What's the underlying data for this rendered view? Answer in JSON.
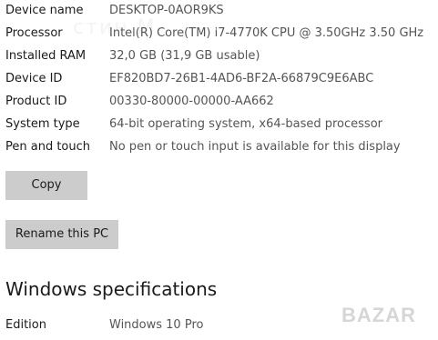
{
  "specs": [
    {
      "label": "Device name",
      "value": "DESKTOP-0AOR9KS"
    },
    {
      "label": "Processor",
      "value": "Intel(R) Core(TM) i7-4770K CPU @ 3.50GHz   3.50 GHz"
    },
    {
      "label": "Installed RAM",
      "value": "32,0 GB (31,9 GB usable)"
    },
    {
      "label": "Device ID",
      "value": "EF820BD7-26B1-4AD6-BF2A-66879C9E6ABC"
    },
    {
      "label": "Product ID",
      "value": "00330-80000-00000-AA662"
    },
    {
      "label": "System type",
      "value": "64-bit operating system, x64-based processor"
    },
    {
      "label": "Pen and touch",
      "value": "No pen or touch input is available for this display"
    }
  ],
  "buttons": {
    "copy_label": "Copy",
    "rename_label": "Rename this PC"
  },
  "windows_specifications": {
    "heading": "Windows specifications",
    "rows": [
      {
        "label": "Edition",
        "value": "Windows 10 Pro"
      }
    ]
  },
  "watermark": {
    "ghost_text": "стин М",
    "logo_text": "BAZAR",
    "color": "#d0d0d0"
  }
}
